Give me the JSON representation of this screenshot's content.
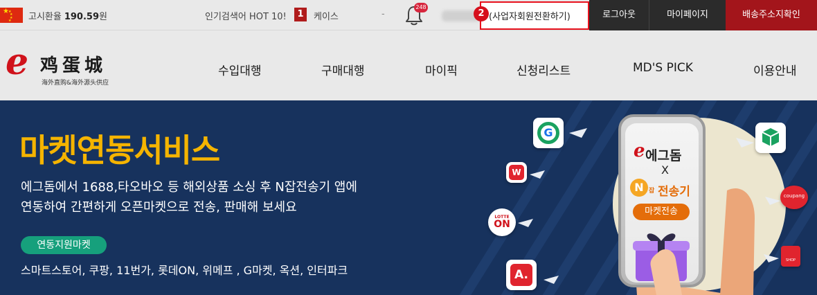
{
  "topbar": {
    "rate_label": "고시환율",
    "rate_value": "190.59",
    "rate_unit": "원",
    "hot_label": "인기검색어 HOT 10!",
    "hot_rank": "1",
    "hot_keyword": "케이스",
    "hot_dash": "-",
    "bell_badge": "248",
    "step_badge": "2",
    "convert_link": "(사업자회원전환하기)",
    "logout": "로그아웃",
    "mypage": "마이페이지",
    "shipping": "배송주소지확인"
  },
  "logo": {
    "mark": "e",
    "name_cn": "鸡蛋城",
    "sub_cn": "海外直购&海外源头供应"
  },
  "nav": {
    "items": [
      "수입대행",
      "구매대행",
      "마이픽",
      "신청리스트",
      "MD'S PICK",
      "이용안내"
    ]
  },
  "banner": {
    "title": "마켓연동서비스",
    "desc_line1": "에그돔에서 1688,타오바오 등 해외상품 소싱 후 N잡전송기 앱에",
    "desc_line2": "연동하여 간편하게 오픈마켓으로 전송, 판매해 보세요",
    "tag": "연동지원마켓",
    "markets": "스마트스토어, 쿠팡, 11번가, 롯데ON, 위메프 , G마켓, 옥션, 인터파크",
    "phone": {
      "e_mark": "e",
      "brand": "에그돔",
      "x": "X",
      "n_mark": "N",
      "n_small": "잡",
      "sender": "전송기",
      "button": "마켓전송"
    },
    "icons": {
      "g_letter": "G",
      "w_letter": "W",
      "lotte_top": "LOTTE",
      "lotte_on": "ON",
      "a_letter": "A.",
      "coupang": "coupang",
      "shop": "SHOP"
    }
  }
}
